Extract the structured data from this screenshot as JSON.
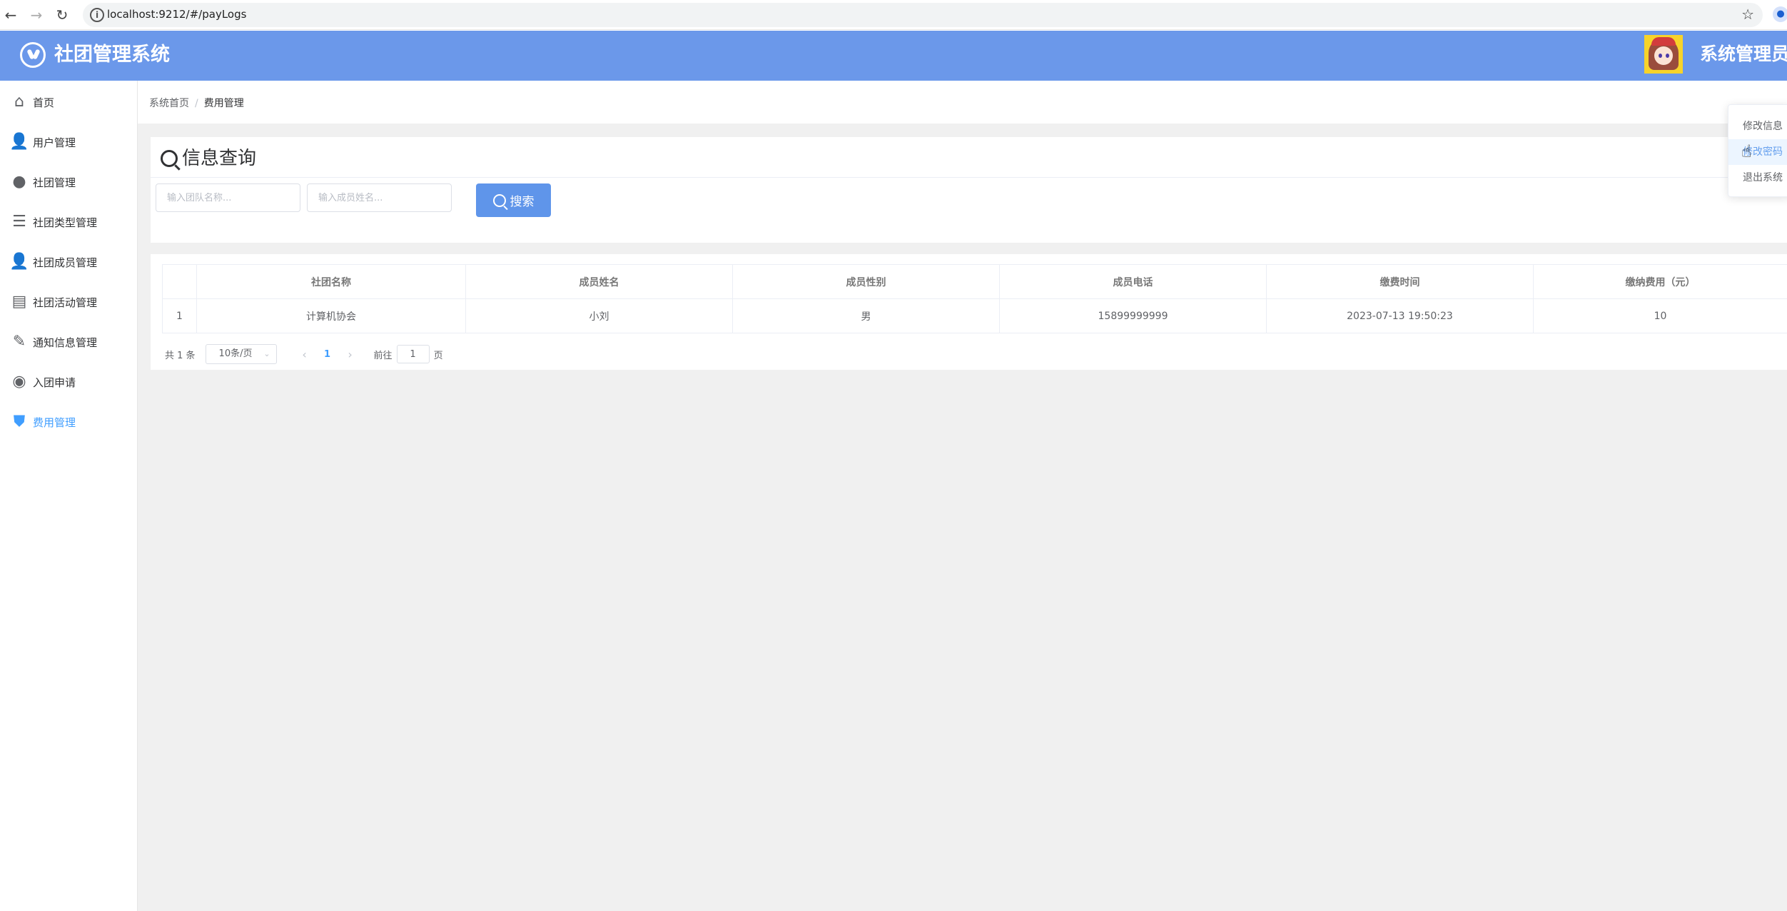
{
  "browser": {
    "url": "localhost:9212/#/payLogs"
  },
  "header": {
    "title": "社团管理系统",
    "user": "系统管理员"
  },
  "sidebar": {
    "items": [
      {
        "label": "首页",
        "icon": "home-icon"
      },
      {
        "label": "用户管理",
        "icon": "user-icon"
      },
      {
        "label": "社团管理",
        "icon": "drop-icon"
      },
      {
        "label": "社团类型管理",
        "icon": "list-icon"
      },
      {
        "label": "社团成员管理",
        "icon": "member-icon"
      },
      {
        "label": "社团活动管理",
        "icon": "document-icon"
      },
      {
        "label": "通知信息管理",
        "icon": "edit-icon"
      },
      {
        "label": "入团申请",
        "icon": "apply-icon"
      },
      {
        "label": "费用管理",
        "icon": "fee-icon",
        "active": true
      }
    ]
  },
  "breadcrumb": {
    "home": "系统首页",
    "separator": "/",
    "current": "费用管理"
  },
  "query": {
    "title": "信息查询",
    "team_placeholder": "输入团队名称...",
    "member_placeholder": "输入成员姓名...",
    "search_label": "搜索"
  },
  "table": {
    "headers": [
      "",
      "社团名称",
      "成员姓名",
      "成员性别",
      "成员电话",
      "缴费时间",
      "缴纳费用（元）"
    ],
    "rows": [
      [
        "1",
        "计算机协会",
        "小刘",
        "男",
        "15899999999",
        "2023-07-13 19:50:23",
        "10"
      ]
    ]
  },
  "pagination": {
    "total": "共 1 条",
    "page_size": "10条/页",
    "current_page": "1",
    "goto_label": "前往",
    "goto_value": "1",
    "page_suffix": "页"
  },
  "dropdown": {
    "items": [
      "修改信息",
      "修改密码",
      "退出系统"
    ]
  },
  "colors": {
    "header_bg": "#6b98ea",
    "accent": "#409eff",
    "button_bg": "#5f95ea"
  }
}
